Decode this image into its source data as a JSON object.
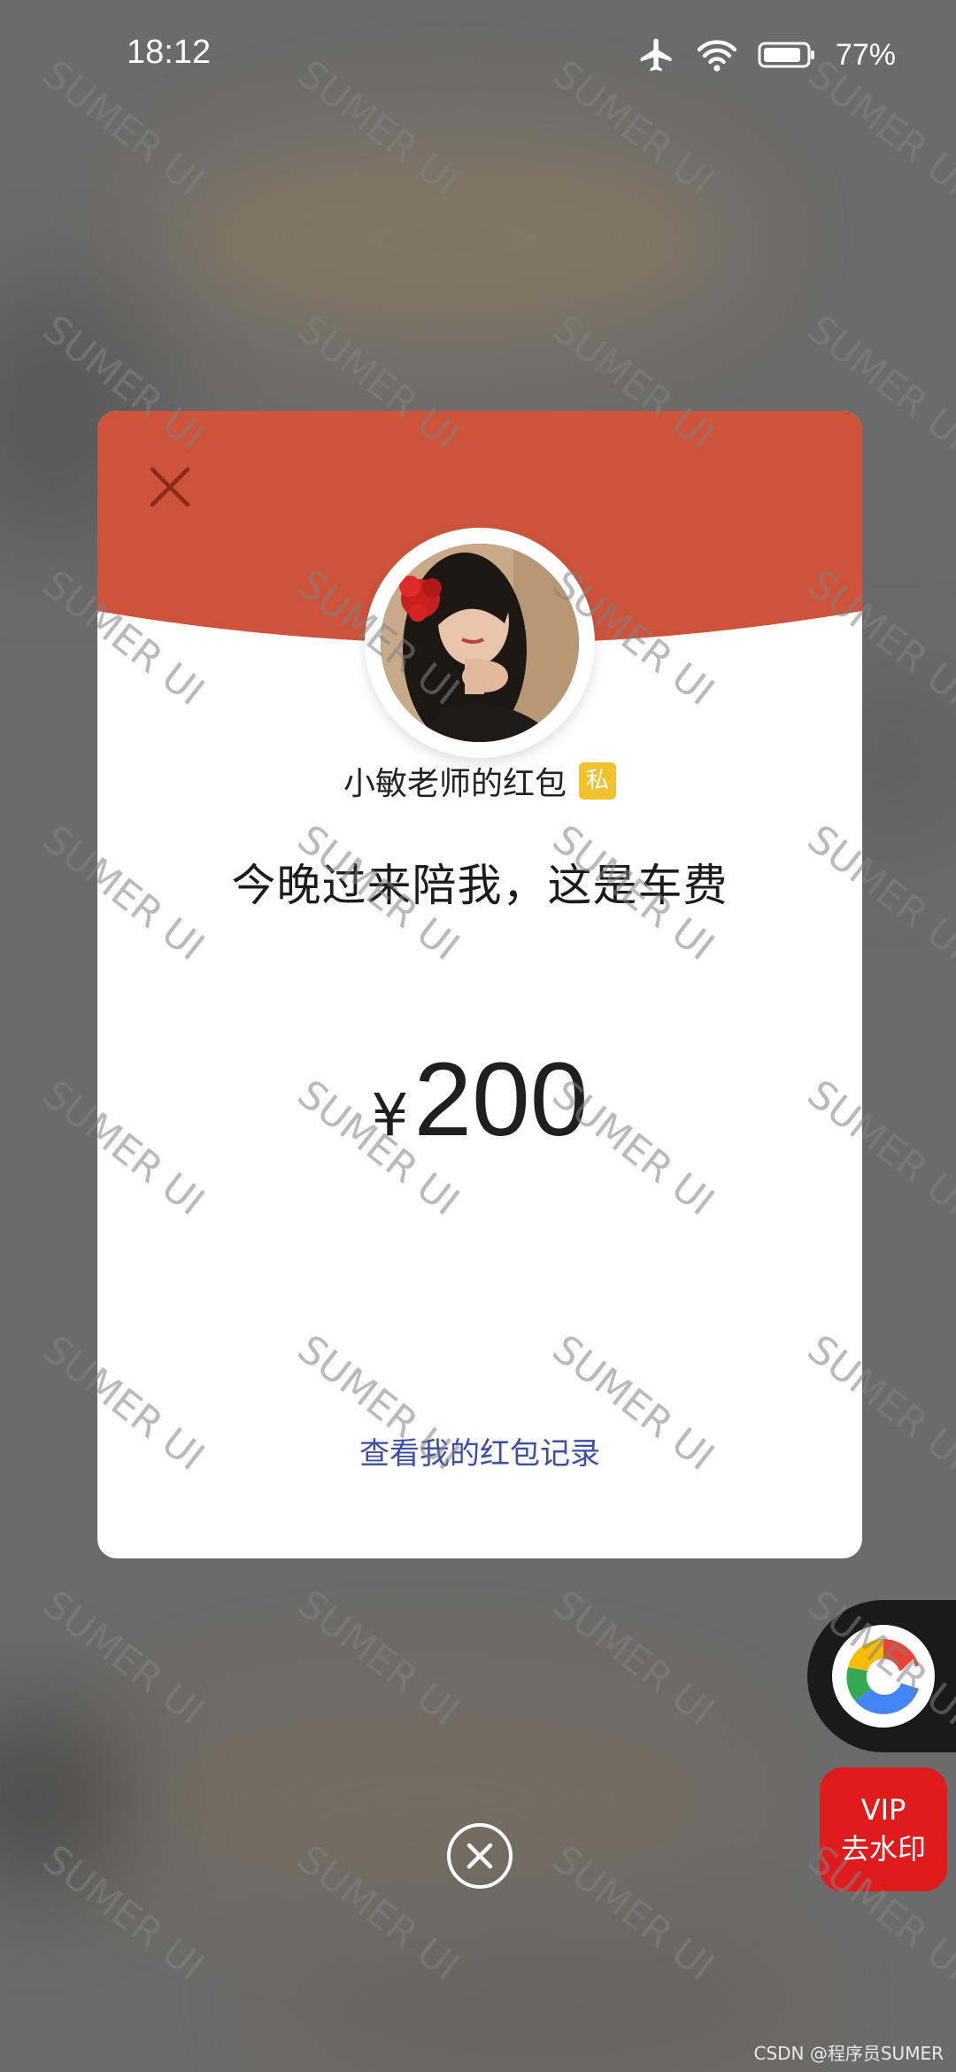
{
  "status_bar": {
    "time": "18:12",
    "battery_percent": "77%",
    "icons": [
      "airplane-mode-icon",
      "wifi-icon",
      "battery-icon"
    ]
  },
  "red_packet": {
    "sender_label": "小敏老师的红包",
    "private_badge": "私",
    "message": "今晚过来陪我，这是车费",
    "currency": "¥",
    "amount": "200",
    "record_link": "查看我的红包记录",
    "header_color": "#cf533b",
    "link_color": "#3d4ea6"
  },
  "floating": {
    "vip_line1": "VIP",
    "vip_line2": "去水印",
    "vip_color": "#e01b1b"
  },
  "watermark": {
    "text": "SUMER UI",
    "footer": "CSDN @程序员SUMER"
  }
}
